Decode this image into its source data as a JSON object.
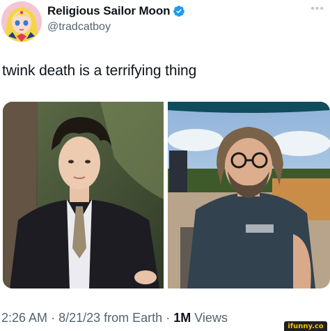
{
  "author": {
    "display_name": "Religious Sailor Moon",
    "handle": "@tradcatboy",
    "verified": true,
    "accent_color": "#1d9bf0"
  },
  "more_icon": "more-horizontal-icon",
  "tweet": {
    "text": "twink death is a terrifying thing"
  },
  "media": [
    {
      "description_icon": "photo-young-man-suit"
    },
    {
      "description_icon": "photo-older-man-glasses"
    }
  ],
  "meta": {
    "time": "2:26 AM",
    "separator": "·",
    "date": "8/21/23",
    "source": "from Earth",
    "views_count": "1M",
    "views_label": "Views"
  },
  "watermark": {
    "text": "ifunny.co"
  }
}
